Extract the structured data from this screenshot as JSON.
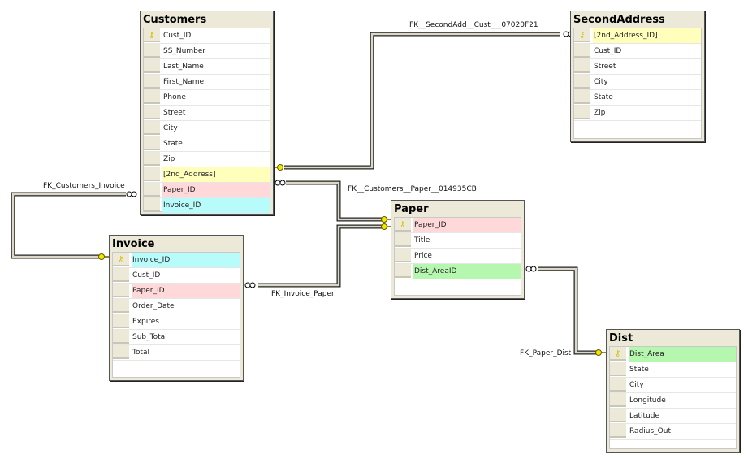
{
  "colors": {
    "fk_yellow": "#ffffbb",
    "fk_pink": "#ffd9d9",
    "fk_cyan": "#b8fbfb",
    "fk_green": "#b6f7b0",
    "key_icon": "#d6c200"
  },
  "tables": [
    {
      "id": "customers",
      "title": "Customers",
      "columns": [
        {
          "name": "Cust_ID",
          "pk": true,
          "highlight": ""
        },
        {
          "name": "SS_Number",
          "pk": false,
          "highlight": ""
        },
        {
          "name": "Last_Name",
          "pk": false,
          "highlight": ""
        },
        {
          "name": "First_Name",
          "pk": false,
          "highlight": ""
        },
        {
          "name": "Phone",
          "pk": false,
          "highlight": ""
        },
        {
          "name": "Street",
          "pk": false,
          "highlight": ""
        },
        {
          "name": "City",
          "pk": false,
          "highlight": ""
        },
        {
          "name": "State",
          "pk": false,
          "highlight": ""
        },
        {
          "name": "Zip",
          "pk": false,
          "highlight": ""
        },
        {
          "name": "[2nd_Address]",
          "pk": false,
          "highlight": "yellow"
        },
        {
          "name": "Paper_ID",
          "pk": false,
          "highlight": "pink"
        },
        {
          "name": "Invoice_ID",
          "pk": false,
          "highlight": "cyan"
        }
      ]
    },
    {
      "id": "secondaddress",
      "title": "SecondAddress",
      "columns": [
        {
          "name": "[2nd_Address_ID]",
          "pk": true,
          "highlight": "yellow"
        },
        {
          "name": "Cust_ID",
          "pk": false,
          "highlight": ""
        },
        {
          "name": "Street",
          "pk": false,
          "highlight": ""
        },
        {
          "name": "City",
          "pk": false,
          "highlight": ""
        },
        {
          "name": "State",
          "pk": false,
          "highlight": ""
        },
        {
          "name": "Zip",
          "pk": false,
          "highlight": ""
        }
      ]
    },
    {
      "id": "paper",
      "title": "Paper",
      "columns": [
        {
          "name": "Paper_ID",
          "pk": true,
          "highlight": "pink"
        },
        {
          "name": "Title",
          "pk": false,
          "highlight": ""
        },
        {
          "name": "Price",
          "pk": false,
          "highlight": ""
        },
        {
          "name": "Dist_AreaID",
          "pk": false,
          "highlight": "green"
        }
      ]
    },
    {
      "id": "invoice",
      "title": "Invoice",
      "columns": [
        {
          "name": "Invoice_ID",
          "pk": true,
          "highlight": "cyan"
        },
        {
          "name": "Cust_ID",
          "pk": false,
          "highlight": ""
        },
        {
          "name": "Paper_ID",
          "pk": false,
          "highlight": "pink"
        },
        {
          "name": "Order_Date",
          "pk": false,
          "highlight": ""
        },
        {
          "name": "Expires",
          "pk": false,
          "highlight": ""
        },
        {
          "name": "Sub_Total",
          "pk": false,
          "highlight": ""
        },
        {
          "name": "Total",
          "pk": false,
          "highlight": ""
        }
      ]
    },
    {
      "id": "dist",
      "title": "Dist",
      "columns": [
        {
          "name": "Dist_Area",
          "pk": true,
          "highlight": "green"
        },
        {
          "name": "State",
          "pk": false,
          "highlight": ""
        },
        {
          "name": "City",
          "pk": false,
          "highlight": ""
        },
        {
          "name": "Longitude",
          "pk": false,
          "highlight": ""
        },
        {
          "name": "Latitude",
          "pk": false,
          "highlight": ""
        },
        {
          "name": "Radius_Out",
          "pk": false,
          "highlight": ""
        }
      ]
    }
  ],
  "relationships": [
    {
      "name": "FK__SecondAdd__Cust___07020F21",
      "one_side": "Customers.[2nd_Address]",
      "many_side": "SecondAddress.[2nd_Address_ID]"
    },
    {
      "name": "FK__Customers__Paper__014935CB",
      "one_side": "Paper.Paper_ID",
      "many_side": "Customers.Paper_ID"
    },
    {
      "name": "FK_Customers_Invoice",
      "one_side": "Invoice.Invoice_ID",
      "many_side": "Customers.Invoice_ID"
    },
    {
      "name": "FK_Invoice_Paper",
      "one_side": "Paper.Paper_ID",
      "many_side": "Invoice.Paper_ID"
    },
    {
      "name": "FK_Paper_Dist",
      "one_side": "Dist.Dist_Area",
      "many_side": "Paper.Dist_AreaID"
    }
  ]
}
